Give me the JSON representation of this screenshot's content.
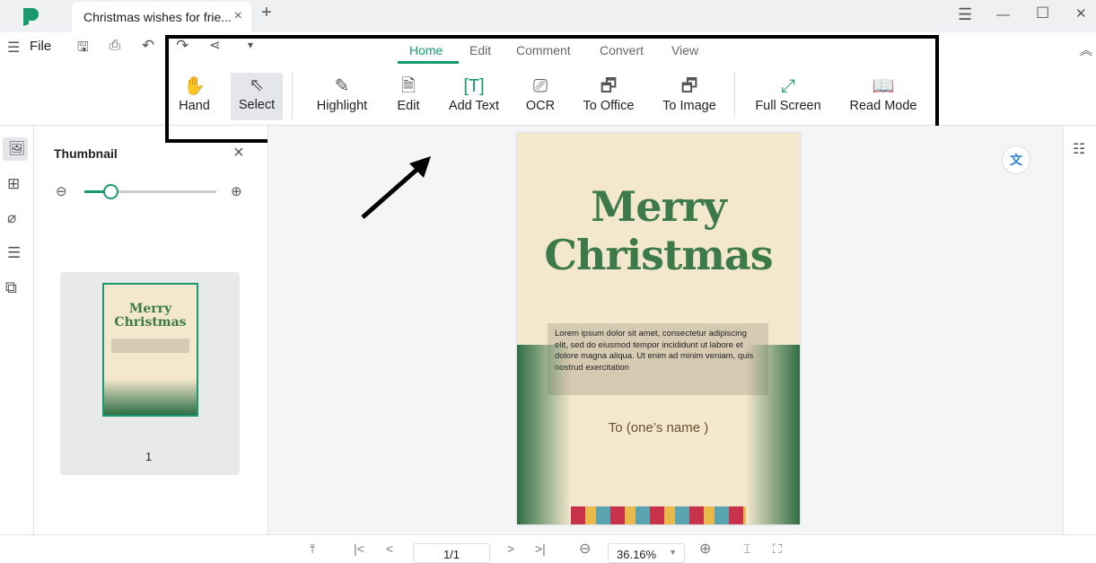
{
  "app": {
    "brand_color": "#1a9a6c"
  },
  "tab": {
    "title": "Christmas wishes for frie...",
    "close": "×",
    "new": "+"
  },
  "window": {
    "menu": "☰",
    "minimize": "—",
    "maximize": "☐",
    "close": "✕"
  },
  "quick": {
    "file": "File"
  },
  "menu_tabs": [
    {
      "label": "Home",
      "active": true
    },
    {
      "label": "Edit"
    },
    {
      "label": "Comment"
    },
    {
      "label": "Convert"
    },
    {
      "label": "View"
    }
  ],
  "tools": [
    {
      "label": "Hand",
      "icon": "hand-icon"
    },
    {
      "label": "Select",
      "icon": "cursor-icon",
      "selected": true
    },
    {
      "label": "Highlight",
      "icon": "highlighter-icon"
    },
    {
      "label": "Edit",
      "icon": "edit-icon"
    },
    {
      "label": "Add Text",
      "icon": "add-text-icon"
    },
    {
      "label": "OCR",
      "icon": "ocr-icon"
    },
    {
      "label": "To Office",
      "icon": "to-office-icon"
    },
    {
      "label": "To Image",
      "icon": "to-image-icon"
    },
    {
      "label": "Full Screen",
      "icon": "fullscreen-icon"
    },
    {
      "label": "Read Mode",
      "icon": "book-icon"
    }
  ],
  "thumbnail": {
    "title": "Thumbnail",
    "close": "×",
    "zoom_level": 0.2,
    "page_label": "1"
  },
  "document": {
    "title1": "Merry",
    "title2": "Christmas",
    "body": "Lorem ipsum dolor sit amet, consectetur adipiscing elit, sed do eiusmod tempor incididunt ut labore et dolore magna aliqua. Ut enim ad minim veniam, quis nostrud exercitation",
    "to": "To (one’s name )"
  },
  "bottom": {
    "page": "1/1",
    "zoom": "36.16%"
  }
}
